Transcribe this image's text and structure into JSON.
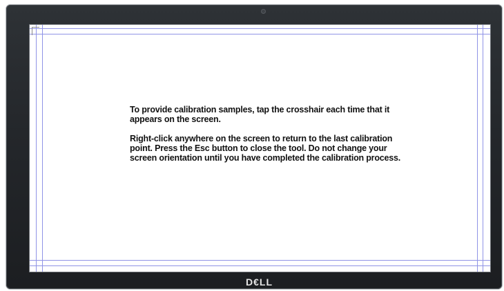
{
  "monitor": {
    "brand_logo": "D€LL"
  },
  "calibration": {
    "paragraph_1": "To provide calibration samples, tap the crosshair each time that it appears on the screen.",
    "paragraph_2": "Right-click anywhere on the screen to return to the last calibration point. Press the Esc button to close the tool. Do not change your screen orientation until you have completed the calibration process."
  },
  "colors": {
    "guide_lines": "#8f93e6",
    "bezel": "#24272b",
    "screen": "#ffffff"
  }
}
